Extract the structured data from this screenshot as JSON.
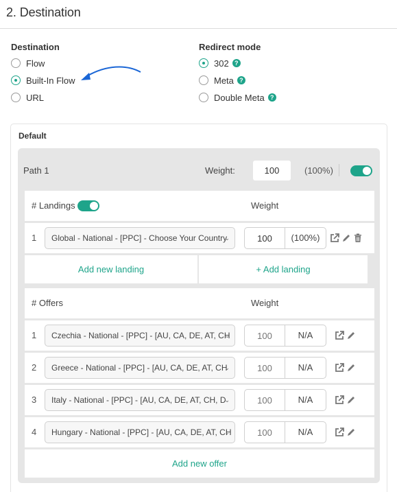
{
  "header": {
    "title": "2. Destination"
  },
  "destination": {
    "label": "Destination",
    "options": [
      {
        "label": "Flow",
        "checked": false
      },
      {
        "label": "Built-In Flow",
        "checked": true
      },
      {
        "label": "URL",
        "checked": false
      }
    ]
  },
  "redirect_mode": {
    "label": "Redirect mode",
    "options": [
      {
        "label": "302",
        "checked": true,
        "help": "?"
      },
      {
        "label": "Meta",
        "checked": false,
        "help": "?"
      },
      {
        "label": "Double Meta",
        "checked": false,
        "help": "?"
      }
    ]
  },
  "annotation": {
    "arrow_color": "#1a66d6"
  },
  "default_card": {
    "label": "Default",
    "path": {
      "title": "Path 1",
      "weight_label": "Weight:",
      "weight_value": "100",
      "weight_pct": "(100%)",
      "enabled": true
    },
    "landings": {
      "header": "# Landings",
      "enabled": true,
      "weight_header": "Weight",
      "rows": [
        {
          "num": "1",
          "name": "Global - National - [PPC] - Choose Your Country",
          "weight": "100",
          "pct": "(100%)"
        }
      ],
      "add_new_label": "Add new landing",
      "add_label": "+ Add landing"
    },
    "offers": {
      "header": "# Offers",
      "weight_header": "Weight",
      "rows": [
        {
          "num": "1",
          "name": "Czechia - National - [PPC] - [AU, CA, DE, AT, CH",
          "weight_placeholder": "100",
          "pct": "N/A"
        },
        {
          "num": "2",
          "name": "Greece - National - [PPC] - [AU, CA, DE, AT, CH",
          "weight_placeholder": "100",
          "pct": "N/A"
        },
        {
          "num": "3",
          "name": "Italy - National - [PPC] - [AU, CA, DE, AT, CH, D",
          "weight_placeholder": "100",
          "pct": "N/A"
        },
        {
          "num": "4",
          "name": "Hungary - National - [PPC] - [AU, CA, DE, AT, CH",
          "weight_placeholder": "100",
          "pct": "N/A"
        }
      ],
      "add_new_label": "Add new offer"
    }
  },
  "colors": {
    "accent": "#1ea48a",
    "path_bg": "#e6e6e6"
  }
}
